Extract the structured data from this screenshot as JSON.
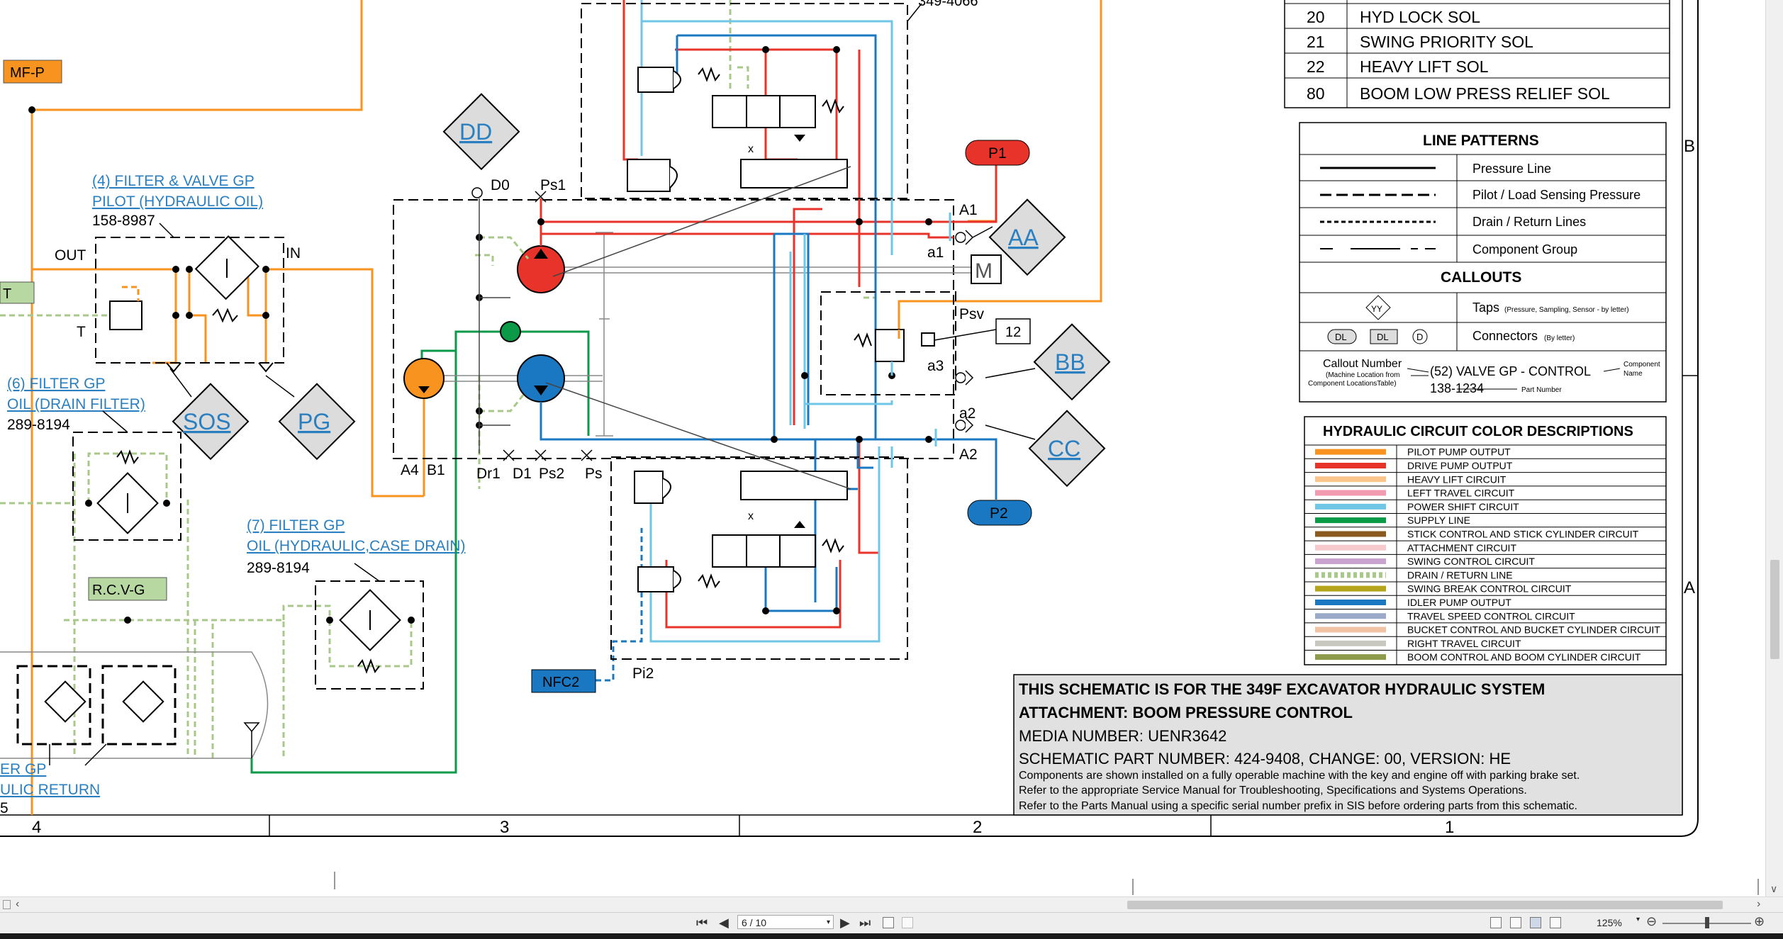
{
  "schematic": {
    "top_callout": "349-4066",
    "mf_p": "MF-P",
    "filter4": {
      "title1": "(4) FILTER & VALVE GP",
      "title2": "PILOT (HYDRAULIC OIL)",
      "part": "158-8987",
      "out": "OUT",
      "in": "IN",
      "t": "T"
    },
    "green_tag_left": "T",
    "filter6": {
      "title1": "(6) FILTER GP",
      "title2": "OIL (DRAIN FILTER)",
      "part": "289-8194"
    },
    "filter7": {
      "title1": "(7) FILTER GP",
      "title2": "OIL (HYDRAULIC,CASE DRAIN)",
      "part": "289-8194"
    },
    "rcvg": "R.C.V-G",
    "filter_bottom": {
      "title1": "ER GP",
      "title2": "ULIC RETURN",
      "part": "5"
    },
    "callouts": {
      "dd": "DD",
      "aa": "AA",
      "bb": "BB",
      "cc": "CC",
      "sos": "SOS",
      "pg": "PG"
    },
    "ports": {
      "d0": "D0",
      "ps1": "Ps1",
      "a1": "A1",
      "a1s": "a1",
      "psv": "Psv",
      "a3": "a3",
      "a2s": "a2",
      "a2": "A2",
      "a4": "A4",
      "b1": "B1",
      "dr1": "Dr1",
      "d1": "D1",
      "ps2": "Ps2",
      "ps": "Ps",
      "pi2": "Pi2",
      "m": "M"
    },
    "p1": "P1",
    "p2": "P2",
    "box12": "12",
    "nfc2": "NFC2",
    "col_numbers": [
      "4",
      "3",
      "2",
      "1"
    ],
    "row_letters": [
      "B",
      "A"
    ]
  },
  "sol_table": [
    {
      "num": "20",
      "name": "HYD LOCK SOL"
    },
    {
      "num": "21",
      "name": "SWING PRIORITY SOL"
    },
    {
      "num": "22",
      "name": "HEAVY LIFT SOL"
    },
    {
      "num": "80",
      "name": "BOOM LOW PRESS RELIEF SOL"
    }
  ],
  "line_patterns": {
    "title": "LINE PATTERNS",
    "rows": [
      "Pressure Line",
      "Pilot / Load Sensing Pressure",
      "Drain / Return Lines",
      "Component Group"
    ],
    "callouts_title": "CALLOUTS",
    "taps": "Taps",
    "taps_note": "(Pressure, Sampling, Sensor - by letter)",
    "tap_symbol": "YY",
    "connectors": "Connectors",
    "connectors_note": "(By letter)",
    "connector_symbols": [
      "DL",
      "DL",
      "D"
    ],
    "example": {
      "callout_number": "Callout Number",
      "machine_loc1": "(Machine Location from",
      "machine_loc2": "Component LocationsTable)",
      "text": "(52) VALVE GP - CONTROL",
      "part": "138-1234",
      "component": "Component",
      "name": "Name",
      "part_number": "Part Number"
    }
  },
  "color_desc": {
    "title": "HYDRAULIC CIRCUIT COLOR DESCRIPTIONS",
    "rows": [
      {
        "color": "#f7931e",
        "style": "solid",
        "label": "PILOT PUMP OUTPUT"
      },
      {
        "color": "#e8332a",
        "style": "solid",
        "label": "DRIVE PUMP OUTPUT"
      },
      {
        "color": "#fbc48a",
        "style": "solid",
        "label": "HEAVY LIFT CIRCUIT"
      },
      {
        "color": "#f29aae",
        "style": "solid",
        "label": "LEFT TRAVEL CIRCUIT"
      },
      {
        "color": "#6fc6e6",
        "style": "solid",
        "label": "POWER SHIFT CIRCUIT"
      },
      {
        "color": "#0a9a48",
        "style": "solid",
        "label": "SUPPLY LINE"
      },
      {
        "color": "#8a5a1e",
        "style": "solid",
        "label": "STICK CONTROL AND STICK CYLINDER CIRCUIT"
      },
      {
        "color": "#f7c8cc",
        "style": "solid",
        "label": "ATTACHMENT CIRCUIT"
      },
      {
        "color": "#c9a2d0",
        "style": "solid",
        "label": "SWING CONTROL CIRCUIT"
      },
      {
        "color": "#a8c88a",
        "style": "dotted",
        "label": "DRAIN / RETURN LINE"
      },
      {
        "color": "#b5a51a",
        "style": "solid",
        "label": "SWING BREAK CONTROL CIRCUIT"
      },
      {
        "color": "#1a78c2",
        "style": "solid",
        "label": "IDLER PUMP OUTPUT"
      },
      {
        "color": "#9aaac8",
        "style": "solid",
        "label": "TRAVEL SPEED CONTROL CIRCUIT"
      },
      {
        "color": "#f2c2a4",
        "style": "solid",
        "label": "BUCKET CONTROL AND BUCKET CYLINDER CIRCUIT"
      },
      {
        "color": "#c8c8c0",
        "style": "solid",
        "label": "RIGHT TRAVEL CIRCUIT"
      },
      {
        "color": "#8c9a4a",
        "style": "solid",
        "label": "BOOM CONTROL AND BOOM CYLINDER CIRCUIT"
      }
    ]
  },
  "title_block": {
    "line1": "THIS SCHEMATIC IS FOR THE 349F EXCAVATOR HYDRAULIC SYSTEM",
    "line2": "ATTACHMENT: BOOM PRESSURE CONTROL",
    "line3": "MEDIA NUMBER: UENR3642",
    "line4": "SCHEMATIC PART NUMBER: 424-9408, CHANGE: 00, VERSION: HE",
    "note1": "Components are shown installed on a fully operable machine with the key and engine off with parking brake set.",
    "note2": "Refer to the appropriate Service Manual for Troubleshooting, Specifications and Systems Operations.",
    "note3": "Refer to the Parts Manual using a specific serial number prefix in SIS before ordering parts from this schematic."
  },
  "viewer": {
    "page": "6 / 10",
    "zoom": "125%"
  },
  "colors": {
    "orange": "#f7931e",
    "red": "#e8332a",
    "blue": "#1a78c2",
    "lightblue": "#6fc6e6",
    "green": "#0a9a48",
    "drain": "#a8c88a",
    "callout_fill": "#dcdcdc",
    "link": "#2a7fc0"
  }
}
